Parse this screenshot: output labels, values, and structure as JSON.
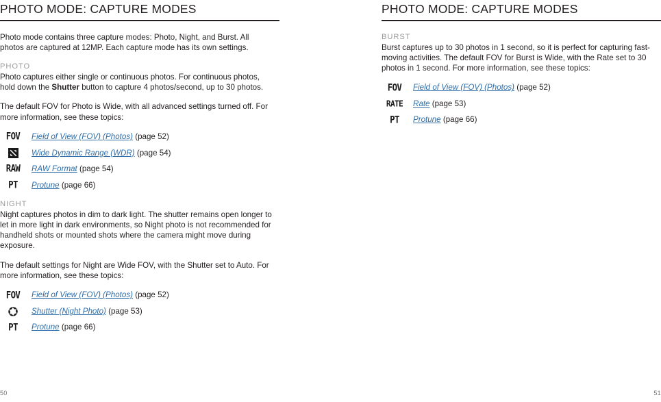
{
  "spread": {
    "left_page": {
      "folio": "50",
      "header": "PHOTO MODE: CAPTURE MODES",
      "intro": "Photo mode contains three capture modes: Photo, Night, and Burst. All photos are captured at 12MP. Each capture mode has its own settings.",
      "sections": [
        {
          "label": "PHOTO",
          "body_pre": "Photo captures either single or continuous photos. For continuous photos, hold down the ",
          "body_bold": "Shutter",
          "body_post": " button to capture 4 photos/second, up to 30 photos.",
          "lead": "The default FOV for Photo is Wide, with all advanced settings turned off. For more information, see these topics:",
          "topics": [
            {
              "icon": "fov-icon",
              "glyph": "FOV",
              "link": "Field of View (FOV) (Photos)",
              "page": " (page 52)"
            },
            {
              "icon": "wdr-icon",
              "glyph": "",
              "link": "Wide Dynamic Range (WDR)",
              "page": " (page 54)"
            },
            {
              "icon": "raw-icon",
              "glyph": "RAW",
              "link": "RAW Format",
              "page": " (page 54)"
            },
            {
              "icon": "protune-icon",
              "glyph": "PT",
              "link": "Protune",
              "page": " (page 66)"
            }
          ]
        },
        {
          "label": "NIGHT",
          "body_pre": "Night captures photos in dim to dark light. The shutter remains open longer to let in more light in dark environments, so Night photo is not recommended for handheld shots or mounted shots where the camera might move during exposure.",
          "body_bold": "",
          "body_post": "",
          "lead": "The default settings for Night are Wide FOV, with the Shutter set to Auto. For more information, see these topics:",
          "topics": [
            {
              "icon": "fov-icon",
              "glyph": "FOV",
              "link": "Field of View (FOV) (Photos)",
              "page": " (page 52)"
            },
            {
              "icon": "shutter-icon",
              "glyph": "",
              "link": "Shutter (Night Photo)",
              "page": " (page 53)"
            },
            {
              "icon": "protune-icon",
              "glyph": "PT",
              "link": "Protune",
              "page": " (page 66)"
            }
          ]
        }
      ]
    },
    "right_page": {
      "folio": "51",
      "header": "PHOTO MODE: CAPTURE MODES",
      "sections": [
        {
          "label": "BURST",
          "body": "Burst captures up to 30 photos in 1 second, so it is perfect for capturing fast-moving activities. The default FOV for Burst is Wide, with the Rate set to 30 photos in 1 second. For more information, see these topics:",
          "topics": [
            {
              "icon": "fov-icon",
              "glyph": "FOV",
              "link": "Field of View (FOV) (Photos)",
              "page": " (page 52)"
            },
            {
              "icon": "rate-icon",
              "glyph": "RATE",
              "link": "Rate",
              "page": " (page 53)"
            },
            {
              "icon": "protune-icon",
              "glyph": "PT",
              "link": "Protune",
              "page": " (page 66)"
            }
          ]
        }
      ]
    }
  },
  "colors": {
    "link": "#2e6da8",
    "section_label": "#9a9a9a",
    "text": "#231f20",
    "rule": "#231f20"
  }
}
